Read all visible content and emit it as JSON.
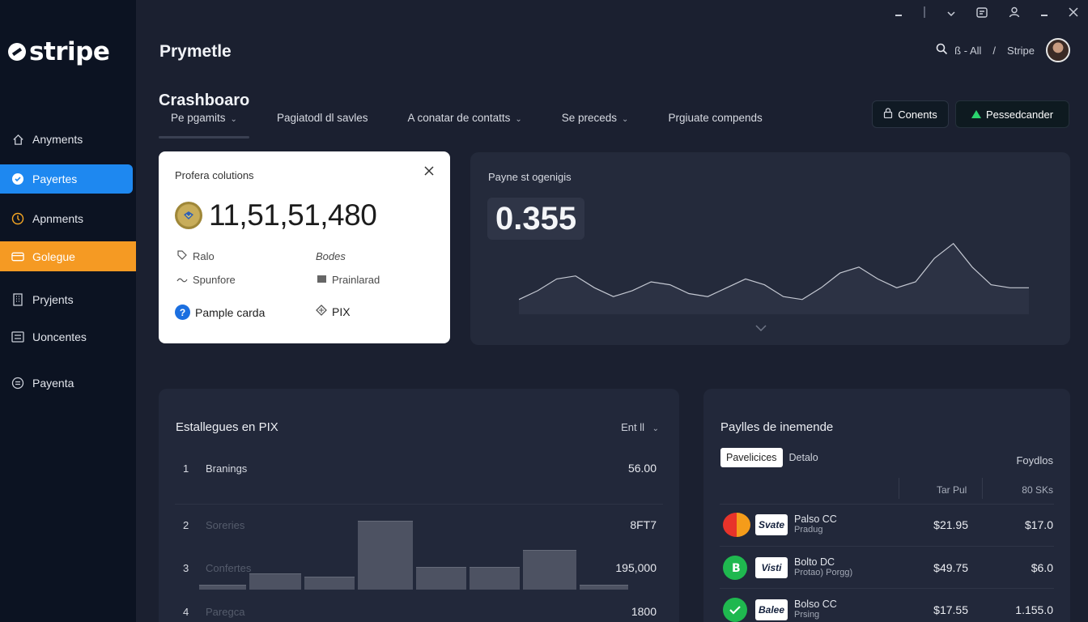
{
  "app": {
    "logo_text": "stripe",
    "page_title": "Prymetle"
  },
  "topbar": {
    "search_text": "ß - All",
    "separator": "/",
    "account_name": "Stripe"
  },
  "sidebar": {
    "items": [
      {
        "label": "Anyments",
        "icon": "home-icon"
      },
      {
        "label": "Payertes",
        "icon": "payments-icon"
      },
      {
        "label": "Apnments",
        "icon": "clock-icon"
      },
      {
        "label": "Golegue",
        "icon": "card-icon"
      },
      {
        "label": "Pryjents",
        "icon": "building-icon"
      },
      {
        "label": "Uoncentes",
        "icon": "list-icon"
      },
      {
        "label": "Payenta",
        "icon": "coin-icon"
      }
    ]
  },
  "section": {
    "title": "Crashboaro",
    "tabs": [
      "Pe pgamits",
      "Pagiatodl dl savles",
      "A conatar de contatts",
      "Se preceds",
      "Prgiuate compends"
    ]
  },
  "header_buttons": {
    "contents": "Conents",
    "primary": "Pessedcander"
  },
  "profile_card": {
    "title": "Profera colutions",
    "amount": "11,51,51,480",
    "rows": [
      {
        "left": "Ralo",
        "right": "Bodes"
      },
      {
        "left": "Spunfore",
        "right": "Prainlarad"
      },
      {
        "left": "Pample carda",
        "right": "PIX"
      }
    ]
  },
  "stat_card": {
    "title": "Payne st ogenigis",
    "value": "0.355"
  },
  "chart_data": {
    "type": "area",
    "title": "",
    "values": [
      10,
      16,
      24,
      26,
      18,
      12,
      16,
      22,
      20,
      14,
      12,
      18,
      24,
      20,
      12,
      10,
      18,
      28,
      32,
      24,
      18,
      22,
      38,
      48,
      32,
      20,
      18,
      18
    ]
  },
  "ranking_card": {
    "title": "Estallegues en PIX",
    "filter": "Ent ll",
    "rows": [
      {
        "rank": "1",
        "label": "Branings",
        "value": "56.00"
      },
      {
        "rank": "2",
        "label": "Soreries",
        "value": "8FT7"
      },
      {
        "rank": "3",
        "label": "Confertes",
        "value": "195,000"
      },
      {
        "rank": "4",
        "label": "Paregca",
        "value": "1800"
      }
    ],
    "bars": [
      0.05,
      0.23,
      0.19,
      1.0,
      0.33,
      0.33,
      0.58,
      0.07
    ]
  },
  "payments_card": {
    "title": "Paylles de inemende",
    "segments": {
      "active": "Pavelicices",
      "other": "Detalo"
    },
    "right_label": "Foydlos",
    "col_headers": [
      "Tar Pul",
      "80 SKs"
    ],
    "rows": [
      {
        "brand": "Svate",
        "name": "Palso CC",
        "sub": "Pradug",
        "amount": "$21.95",
        "fee": "$17.0"
      },
      {
        "brand": "Visti",
        "name": "Bolto DC",
        "sub": "Protao) Porgg)",
        "amount": "$49.75",
        "fee": "$6.0"
      },
      {
        "brand": "Balee",
        "name": "Bolso CC",
        "sub": "Prsing",
        "amount": "$17.55",
        "fee": "1.155.0"
      }
    ]
  }
}
